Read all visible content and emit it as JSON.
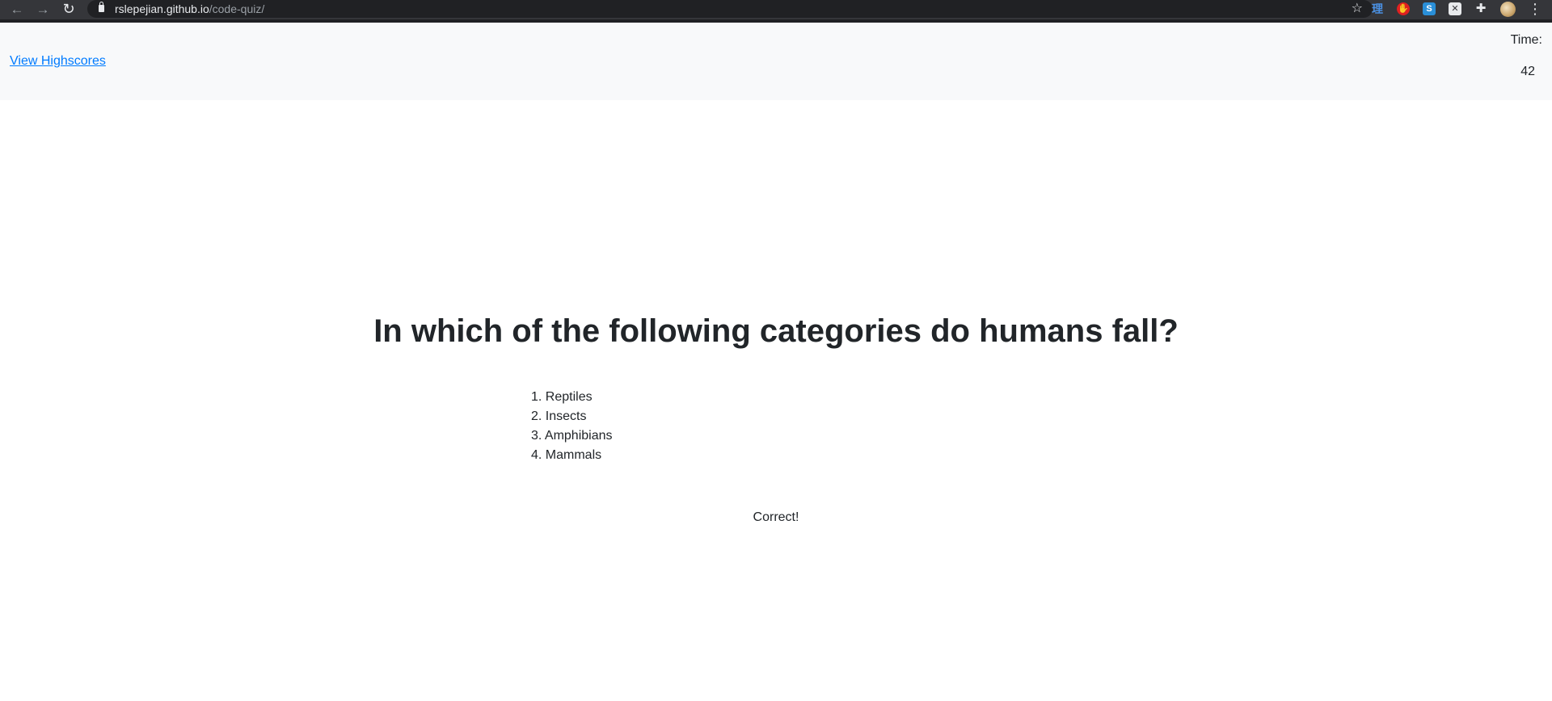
{
  "browser": {
    "url_host": "rslepejian.github.io",
    "url_path": "/code-quiz/",
    "back_icon": "←",
    "forward_icon": "→",
    "reload_icon": "↻",
    "star_icon": "☆",
    "extension_1": "理",
    "extension_2": "✋",
    "extension_3": "S",
    "extension_4": "✕",
    "extension_5": "✚",
    "menu_icon": "⋮"
  },
  "header": {
    "highscores_link": "View Highscores",
    "timer_label": "Time:",
    "timer_value": "42"
  },
  "quiz": {
    "question": "In which of the following categories do humans fall?",
    "choices": [
      "1. Reptiles",
      "2. Insects",
      "3. Amphibians",
      "4. Mammals"
    ],
    "feedback": "Correct!"
  },
  "colors": {
    "link": "#007bff",
    "header_bg": "#f8f9fa",
    "text": "#212529",
    "browser_bar": "#35363a"
  }
}
